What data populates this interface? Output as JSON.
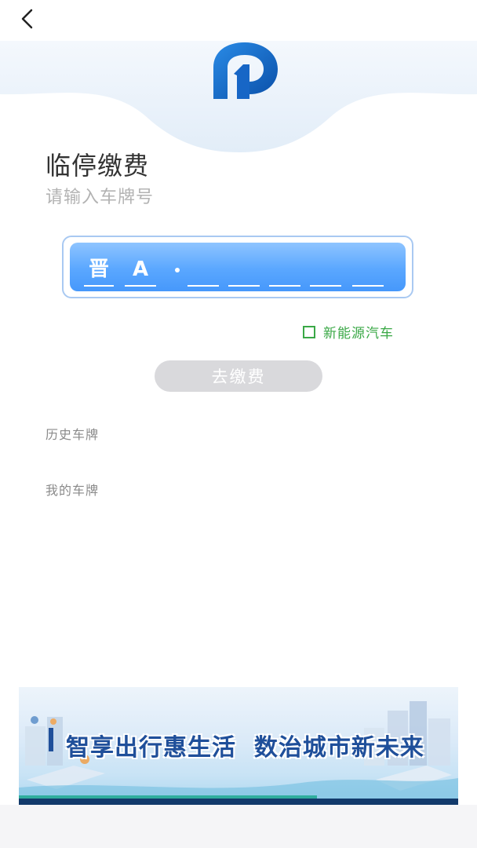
{
  "header": {
    "back_icon": "chevron-left-icon",
    "logo_icon": "parking-p-logo-icon",
    "brand_color": "#1b6fd1"
  },
  "page": {
    "title": "临停缴费",
    "subtitle": "请输入车牌号"
  },
  "plate": {
    "province": "晋",
    "letter": "A",
    "separator_icon": "dot-icon",
    "remaining_slots": [
      "",
      "",
      "",
      "",
      ""
    ],
    "plate_color": "#5aa7ff",
    "frame_color": "#a9c9f2"
  },
  "options": {
    "new_energy_label": "新能源汽车",
    "new_energy_checked": false,
    "new_energy_color": "#3aa846"
  },
  "actions": {
    "pay_label": "去缴费",
    "pay_enabled": false
  },
  "sections": {
    "history_label": "历史车牌",
    "my_plates_label": "我的车牌"
  },
  "banner": {
    "text": "智享出行惠生活  数治城市新未来",
    "text_color": "#1f4f9a"
  }
}
